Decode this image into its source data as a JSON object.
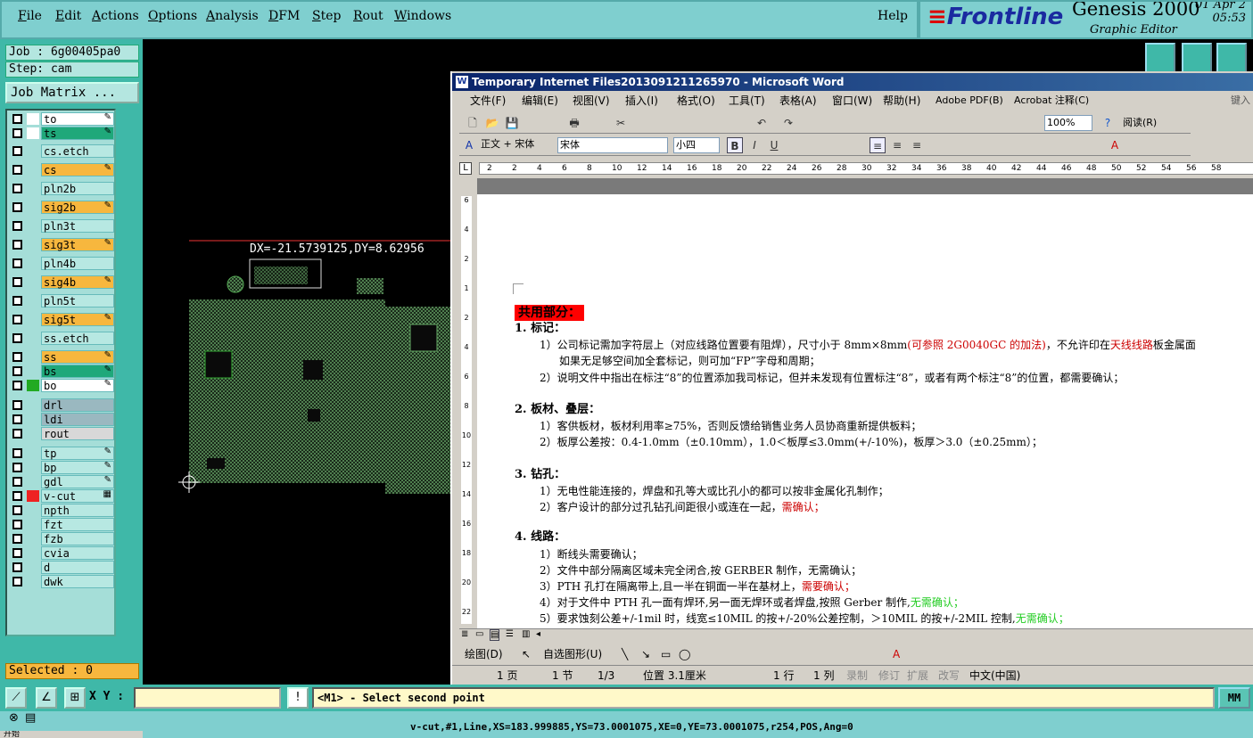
{
  "menu": {
    "file": "File",
    "edit": "Edit",
    "actions": "Actions",
    "options": "Options",
    "analysis": "Analysis",
    "dfm": "DFM",
    "step": "Step",
    "rout": "Rout",
    "windows": "Windows",
    "help": "Help"
  },
  "brand": {
    "logo": "Frontline",
    "product": "Genesis 2000",
    "subtitle": "Graphic Editor",
    "date": "01 Apr 2",
    "time": "05:53"
  },
  "job": {
    "job_label": "Job : 6g00405pa0",
    "step_label": "Step: cam",
    "matrix_button": "Job Matrix ..."
  },
  "layers": [
    {
      "name": "to",
      "color": "#ffffff",
      "flag": "✎",
      "sw": "#fff"
    },
    {
      "name": "ts",
      "color": "#1fa87a",
      "flag": "✎",
      "sw": "#fff"
    },
    {
      "name": "cs.etch",
      "color": "#b7e8e2",
      "flag": "",
      "sw": ""
    },
    {
      "name": "cs",
      "color": "#f7b73e",
      "flag": "✎",
      "sw": ""
    },
    {
      "name": "pln2b",
      "color": "#b7e8e2",
      "flag": "",
      "sw": ""
    },
    {
      "name": "sig2b",
      "color": "#f7b73e",
      "flag": "✎",
      "sw": ""
    },
    {
      "name": "pln3t",
      "color": "#b7e8e2",
      "flag": "",
      "sw": ""
    },
    {
      "name": "sig3t",
      "color": "#f7b73e",
      "flag": "✎",
      "sw": ""
    },
    {
      "name": "pln4b",
      "color": "#b7e8e2",
      "flag": "",
      "sw": ""
    },
    {
      "name": "sig4b",
      "color": "#f7b73e",
      "flag": "✎",
      "sw": ""
    },
    {
      "name": "pln5t",
      "color": "#b7e8e2",
      "flag": "",
      "sw": ""
    },
    {
      "name": "sig5t",
      "color": "#f7b73e",
      "flag": "✎",
      "sw": ""
    },
    {
      "name": "ss.etch",
      "color": "#b7e8e2",
      "flag": "",
      "sw": ""
    },
    {
      "name": "ss",
      "color": "#f7b73e",
      "flag": "✎",
      "sw": ""
    },
    {
      "name": "bs",
      "color": "#1fa87a",
      "flag": "✎",
      "sw": ""
    },
    {
      "name": "bo",
      "color": "#ffffff",
      "flag": "✎",
      "sw": "#2a2"
    },
    {
      "name": "drl",
      "color": "#9ab8c0",
      "flag": "",
      "sw": ""
    },
    {
      "name": "ldi",
      "color": "#9ab8c0",
      "flag": "",
      "sw": ""
    },
    {
      "name": "rout",
      "color": "#d8d8d8",
      "flag": "",
      "sw": ""
    },
    {
      "name": "tp",
      "color": "#b7e8e2",
      "flag": "✎",
      "sw": ""
    },
    {
      "name": "bp",
      "color": "#b7e8e2",
      "flag": "✎",
      "sw": ""
    },
    {
      "name": "gdl",
      "color": "#b7e8e2",
      "flag": "✎",
      "sw": ""
    },
    {
      "name": "v-cut",
      "color": "#b7e8e2",
      "flag": "▦",
      "sw": "#e22"
    },
    {
      "name": "npth",
      "color": "#b7e8e2",
      "flag": "",
      "sw": ""
    },
    {
      "name": "fzt",
      "color": "#b7e8e2",
      "flag": "",
      "sw": ""
    },
    {
      "name": "fzb",
      "color": "#b7e8e2",
      "flag": "",
      "sw": ""
    },
    {
      "name": "cvia",
      "color": "#b7e8e2",
      "flag": "",
      "sw": ""
    },
    {
      "name": "d",
      "color": "#b7e8e2",
      "flag": "",
      "sw": ""
    },
    {
      "name": "dwk",
      "color": "#b7e8e2",
      "flag": "",
      "sw": ""
    }
  ],
  "selected": "Selected : 0",
  "canvas": {
    "measure": "DX=-21.5739125,DY=8.62956"
  },
  "word": {
    "title": "Temporary Internet Files2013091211265970 - Microsoft Word",
    "menu": [
      "文件(F)",
      "编辑(E)",
      "视图(V)",
      "插入(I)",
      "格式(O)",
      "工具(T)",
      "表格(A)",
      "窗口(W)",
      "帮助(H)",
      "Adobe PDF(B)",
      "Acrobat 注释(C)",
      "键入"
    ],
    "zoom": "100%",
    "read_btn": "阅读(R)",
    "style": "正文 + 宋体",
    "font": "宋体",
    "size": "小四",
    "ruler": [
      "2",
      "2",
      "4",
      "6",
      "8",
      "10",
      "12",
      "14",
      "16",
      "18",
      "20",
      "22",
      "24",
      "26",
      "28",
      "30",
      "32",
      "34",
      "36",
      "38",
      "40",
      "42",
      "44",
      "46",
      "48",
      "50",
      "52",
      "54",
      "56",
      "58"
    ],
    "vruler": [
      "6",
      "4",
      "2",
      "1",
      "2",
      "4",
      "6",
      "8",
      "10",
      "12",
      "14",
      "16",
      "18",
      "20",
      "22"
    ],
    "doc": {
      "heading": "共用部分：",
      "s1": "1.  标记：",
      "s1_1a": "1）公司标记需加字符层上（对应线路位置要有阻焊），尺寸小于 8mm×8mm",
      "s1_1b": "(可参照 2G0040GC 的加法)",
      "s1_1c": "，不允许印在",
      "s1_1d": "天线线路",
      "s1_1e": "板金属面",
      "s1_1f": "如果无足够空间加全套标记，则可加“FP”字母和周期；",
      "s1_2": "2）说明文件中指出在标注“8”的位置添加我司标记，但并未发现有位置标注“8”，或者有两个标注“8”的位置，都需要确认；",
      "s2": "2.  板材、叠层：",
      "s2_1": "1）客供板材，板材利用率≥75%，否则反馈给销售业务人员协商重新提供板料；",
      "s2_2": "2）板厚公差按：0.4-1.0mm（±0.10mm），1.0＜板厚≤3.0mm(+/-10%)，板厚＞3.0（±0.25mm）；",
      "s3": "3.  钻孔：",
      "s3_1": "1）无电性能连接的，焊盘和孔等大或比孔小的都可以按非金属化孔制作；",
      "s3_2a": "2）客户设计的部分过孔钻孔间距很小或连在一起，",
      "s3_2b": "需确认；",
      "s4": "4.  线路：",
      "s4_1": "1）断线头需要确认；",
      "s4_2": "2）文件中部分隔离区域未完全闭合,按 GERBER 制作，无需确认；",
      "s4_3a": "3）PTH 孔打在隔离带上,且一半在铜面一半在基材上，",
      "s4_3b": "需要确认；",
      "s4_4a": "4）对于文件中 PTH 孔一面有焊环,另一面无焊环或者焊盘,按照 Gerber 制作,",
      "s4_4b": "无需确认；",
      "s4_5a": "5）要求蚀刻公差+/-1mil 时，线宽≤10MIL 的按+/-20%公差控制，＞10MIL 的按+/-2MIL 控制,",
      "s4_5b": "无需确认；"
    },
    "draw": {
      "draw_label": "绘图(D)",
      "autoshape_label": "自选图形(U)"
    },
    "status": {
      "page": "1 页",
      "section": "1 节",
      "pages": "1/3",
      "position": "位置 3.1厘米",
      "line": "1 行",
      "col": "1 列",
      "rec": "录制",
      "trk": "修订",
      "ext": "扩展",
      "ovr": "改写",
      "lang": "中文(中国)"
    }
  },
  "bottom": {
    "xy_label": "X Y :",
    "xy_value": "",
    "prompt": "<M1> - Select second point",
    "units": "MM",
    "status": "v-cut,#1,Line,XS=183.999885,YS=73.0001075,XE=0,YE=73.0001075,r254,POS,Ang=0"
  },
  "taskbar": {
    "start": "开始"
  }
}
